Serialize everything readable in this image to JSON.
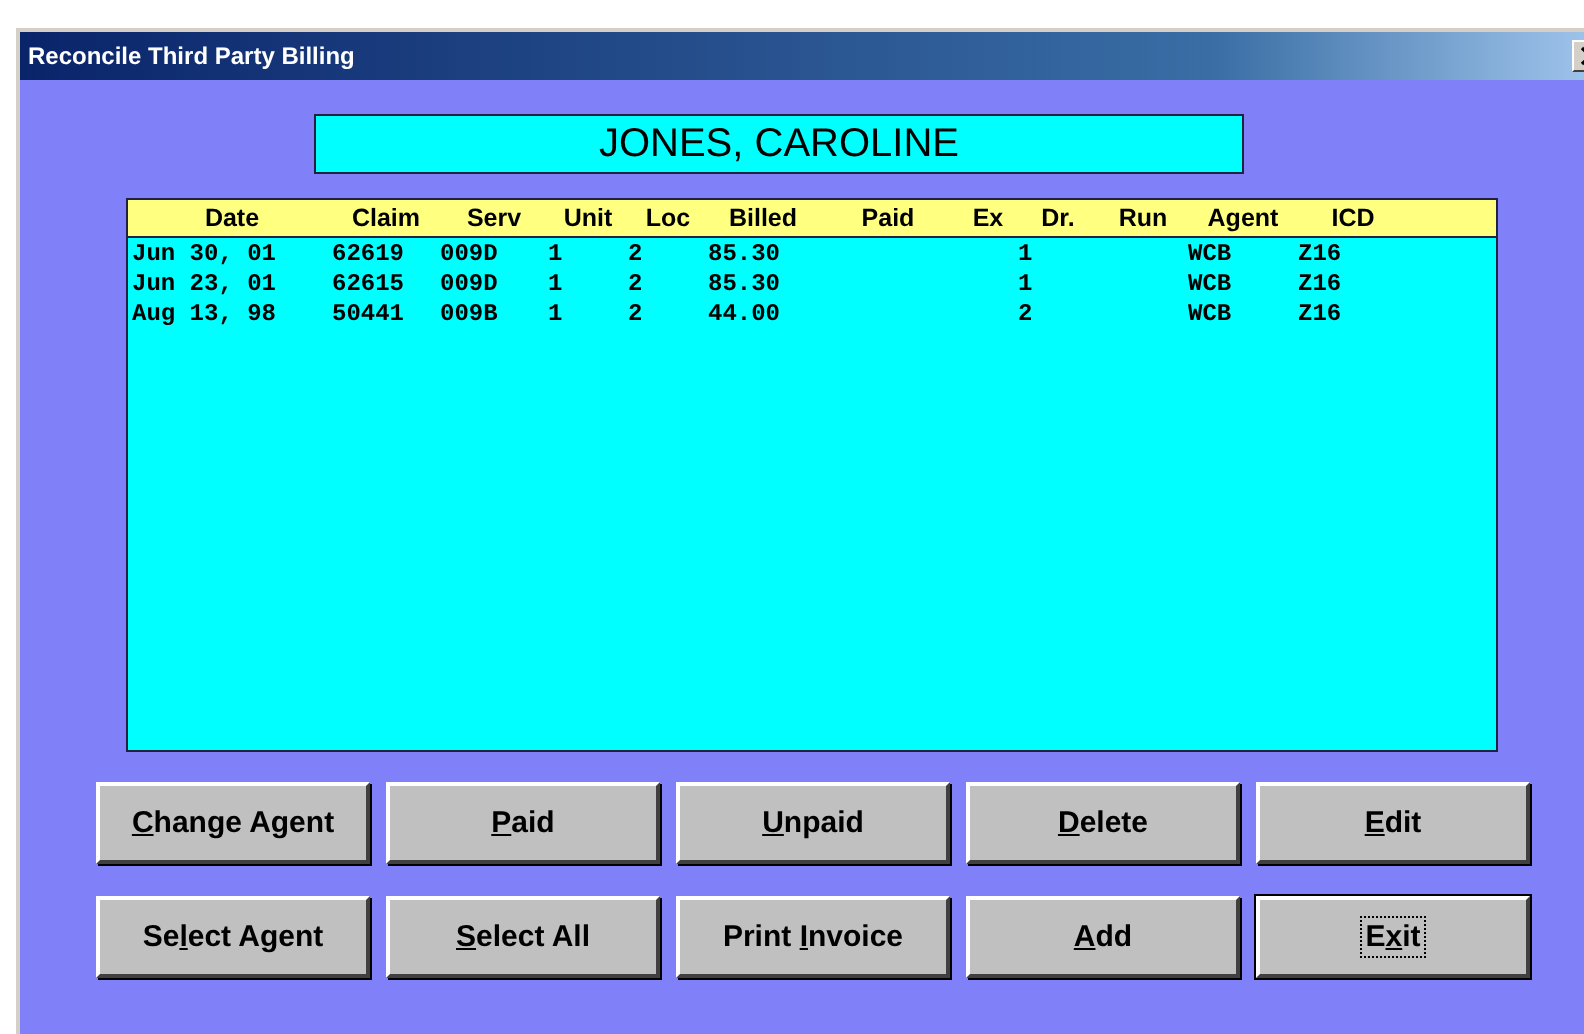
{
  "window": {
    "title": "Reconcile Third Party Billing"
  },
  "patient_name": "JONES, CAROLINE",
  "table": {
    "columns": [
      "Date",
      "Claim",
      "Serv",
      "Unit",
      "Loc",
      "Billed",
      "Paid",
      "Ex",
      "Dr.",
      "Run",
      "Agent",
      "ICD"
    ],
    "rows": [
      {
        "date": "Jun 30, 01",
        "claim": "62619",
        "serv": "009D",
        "unit": "1",
        "loc": "2",
        "billed": "85.30",
        "dr": "1",
        "agent": "WCB",
        "icd": "Z16"
      },
      {
        "date": "Jun 23, 01",
        "claim": "62615",
        "serv": "009D",
        "unit": "1",
        "loc": "2",
        "billed": "85.30",
        "dr": "1",
        "agent": "WCB",
        "icd": "Z16"
      },
      {
        "date": "Aug 13, 98",
        "claim": "50441",
        "serv": "009B",
        "unit": "1",
        "loc": "2",
        "billed": "44.00",
        "dr": "2",
        "agent": "WCB",
        "icd": "Z16"
      }
    ]
  },
  "buttons": [
    {
      "key": "C",
      "after": "hange Agent",
      "default": false
    },
    {
      "key": "P",
      "after": "aid",
      "default": false
    },
    {
      "key": "U",
      "after": "npaid",
      "default": false
    },
    {
      "key": "D",
      "after": "elete",
      "default": false
    },
    {
      "key": "E",
      "after": "dit",
      "default": false
    },
    {
      "before": "Se",
      "key": "l",
      "after": "ect Agent",
      "default": false
    },
    {
      "key": "S",
      "after": "elect All",
      "default": false
    },
    {
      "before": "Print ",
      "key": "I",
      "after": "nvoice",
      "default": false
    },
    {
      "key": "A",
      "after": "dd",
      "default": false
    },
    {
      "before": "E",
      "key": "x",
      "after": "it",
      "default": true
    }
  ]
}
